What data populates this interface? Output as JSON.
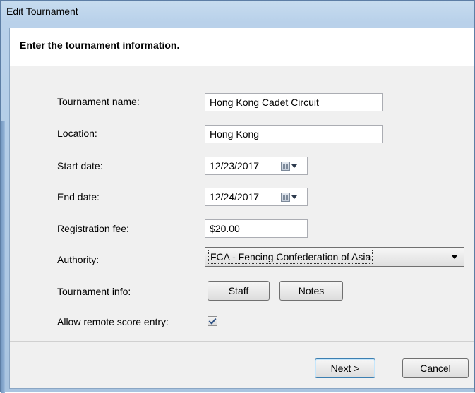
{
  "window": {
    "title": "Edit Tournament",
    "header": "Enter the tournament information."
  },
  "form": {
    "tournament_name": {
      "label": "Tournament name:",
      "value": "Hong Kong Cadet Circuit"
    },
    "location": {
      "label": "Location:",
      "value": "Hong Kong"
    },
    "start_date": {
      "label": "Start date:",
      "value": "12/23/2017",
      "icon": "calendar-icon"
    },
    "end_date": {
      "label": "End date:",
      "value": "12/24/2017",
      "icon": "calendar-icon"
    },
    "registration_fee": {
      "label": "Registration fee:",
      "value": "$20.00"
    },
    "authority": {
      "label": "Authority:",
      "value": "FCA - Fencing Confederation of Asia"
    },
    "tournament_info": {
      "label": "Tournament info:",
      "staff_button": "Staff",
      "notes_button": "Notes"
    },
    "remote_score": {
      "label": "Allow remote score entry:",
      "checked": true
    }
  },
  "buttons": {
    "next": "Next >",
    "cancel": "Cancel"
  }
}
